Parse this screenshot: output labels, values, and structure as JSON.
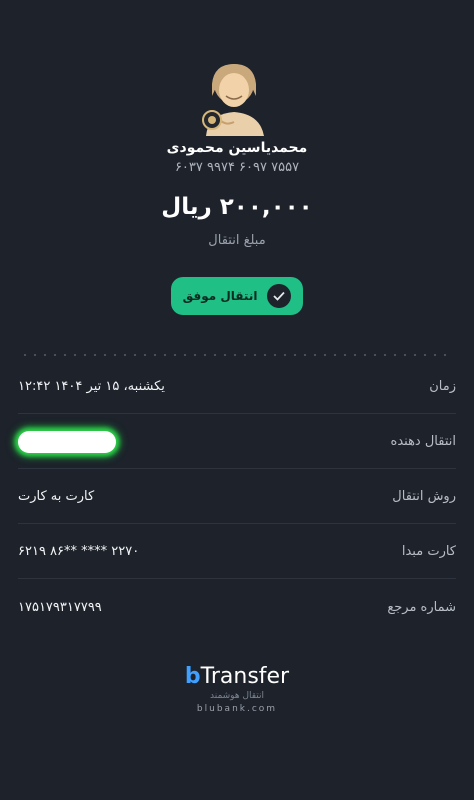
{
  "recipient": {
    "name": "محمدیاسین محمودی",
    "card_number": "۶۰۳۷ ۹۹۷۴ ۶۰۹۷ ۷۵۵۷"
  },
  "transfer": {
    "amount": "۲۰۰,۰۰۰ ریال",
    "amount_label": "مبلغ انتقال",
    "status": "انتقال موفق",
    "status_icon": "check-circle-icon",
    "accent_color": "#1fbf86"
  },
  "details": [
    {
      "label": "زمان",
      "value": "۱۲:۴۲ یکشنبه، ۱۵ تیر ۱۴۰۴"
    },
    {
      "label": "انتقال دهنده",
      "value": ""
    },
    {
      "label": "روش انتقال",
      "value": "کارت به کارت"
    },
    {
      "label": "کارت مبدا",
      "value": "۶۲۱۹ ۸۶** **** ۲۲۷۰"
    },
    {
      "label": "شماره مرجع",
      "value": "۱۷۵۱۷۹۳۱۷۷۹۹"
    }
  ],
  "footer": {
    "brand_b": "b",
    "brand_rest": "Transfer",
    "tagline": "انتقال هوشمند",
    "url": "blubank.com"
  }
}
